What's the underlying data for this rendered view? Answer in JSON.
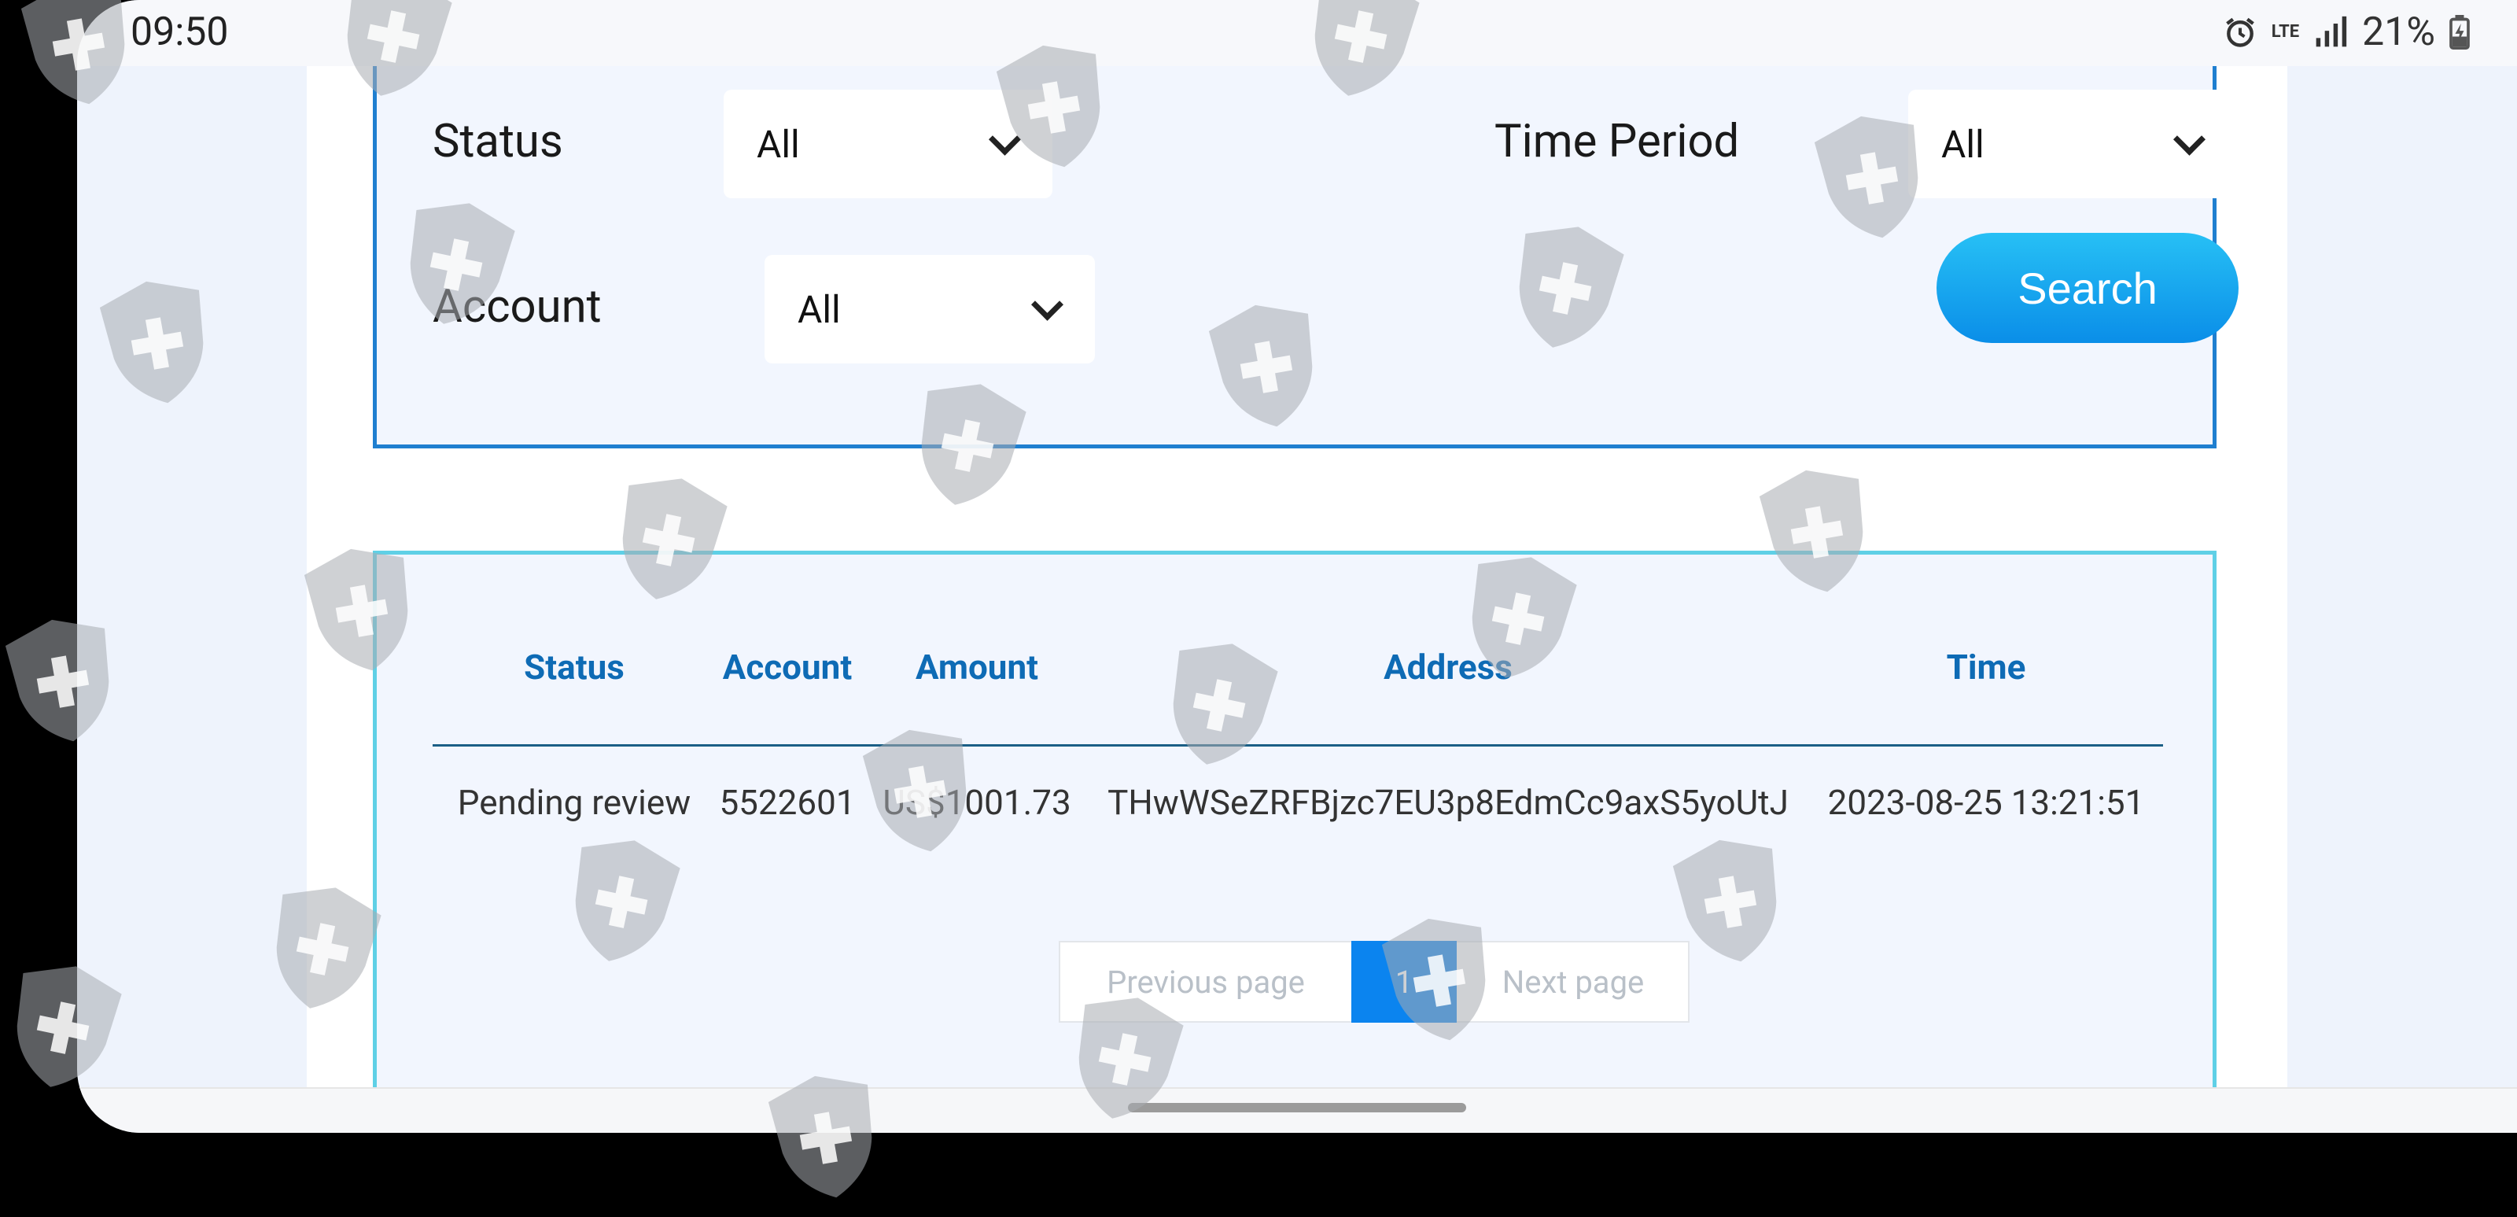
{
  "status_bar": {
    "time": "09:50",
    "network": "LTE",
    "battery": "21%"
  },
  "filters": {
    "status_label": "Status",
    "status_value": "All",
    "period_label": "Time Period",
    "period_value": "All",
    "account_label": "Account",
    "account_value": "All",
    "search_label": "Search"
  },
  "table": {
    "headers": [
      "Status",
      "Account",
      "Amount",
      "Address",
      "Time"
    ],
    "rows": [
      [
        "Pending review",
        "5522601",
        "US$1001.73",
        "THwWSeZRFBjzc7EU3p8EdmCc9axS5yoUtJ",
        "2023-08-25 13:21:51"
      ]
    ]
  },
  "pagination": {
    "prev": "Previous page",
    "current": "1",
    "next": "Next page"
  },
  "colors": {
    "accent": "#0b84ef",
    "header_text": "#0e6bb5",
    "panel_border_top": "#1f7fd0",
    "panel_border_table": "#5fd0e6"
  },
  "watermark_icon": "shield-plus-icon"
}
